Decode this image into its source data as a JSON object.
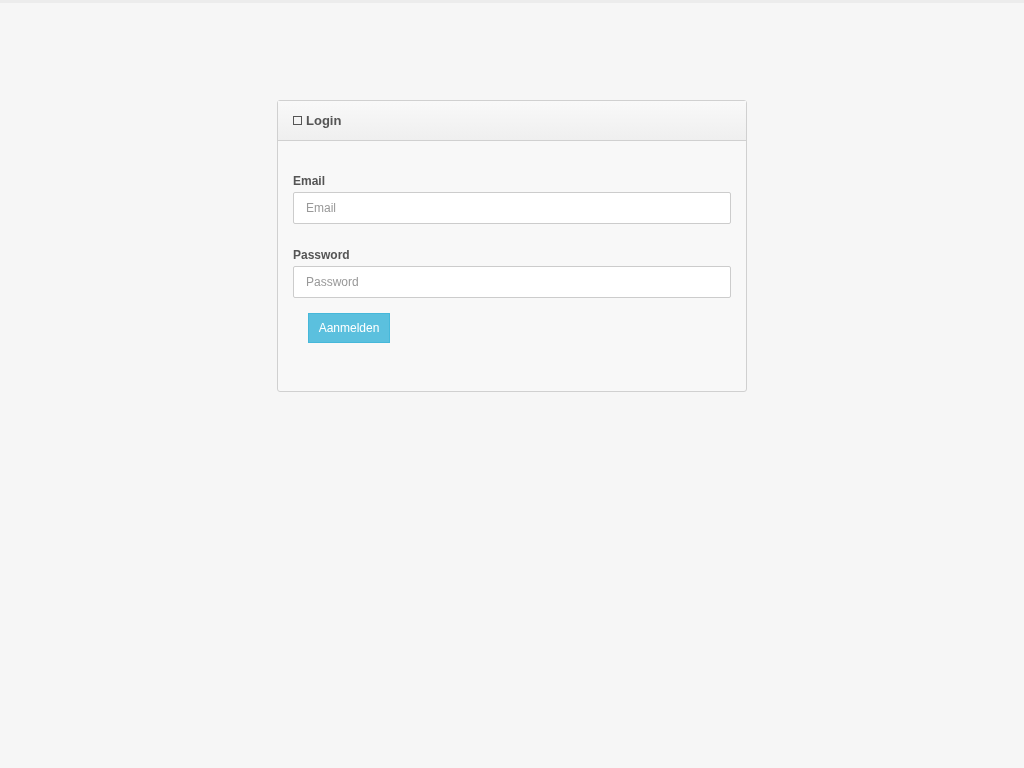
{
  "panel": {
    "title": "Login"
  },
  "fields": [
    {
      "label": "Email",
      "placeholder": "Email"
    },
    {
      "label": "Password",
      "placeholder": "Password"
    }
  ],
  "submit_button": "Aanmelden"
}
